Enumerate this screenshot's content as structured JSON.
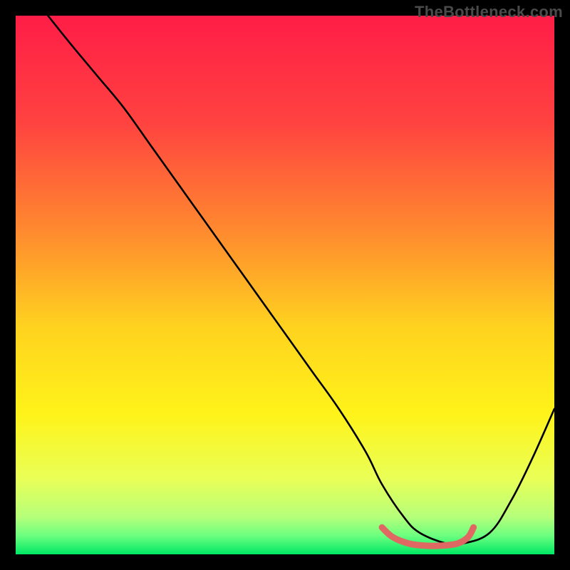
{
  "watermark": "TheBottleneck.com",
  "chart_data": {
    "type": "line",
    "title": "",
    "xlabel": "",
    "ylabel": "",
    "xlim": [
      0,
      100
    ],
    "ylim": [
      0,
      100
    ],
    "grid": false,
    "legend": false,
    "gradient_stops": [
      {
        "offset": 0.0,
        "color": "#ff1d47"
      },
      {
        "offset": 0.2,
        "color": "#ff4340"
      },
      {
        "offset": 0.4,
        "color": "#ff8a2f"
      },
      {
        "offset": 0.58,
        "color": "#ffd31f"
      },
      {
        "offset": 0.74,
        "color": "#fff31a"
      },
      {
        "offset": 0.86,
        "color": "#e9ff57"
      },
      {
        "offset": 0.93,
        "color": "#b6ff7a"
      },
      {
        "offset": 0.965,
        "color": "#6dff7f"
      },
      {
        "offset": 1.0,
        "color": "#00e865"
      }
    ],
    "series": [
      {
        "name": "bottleneck-curve",
        "color": "#000000",
        "x": [
          6,
          10,
          15,
          20,
          25,
          30,
          35,
          40,
          45,
          50,
          55,
          60,
          65,
          68,
          72,
          75,
          80,
          83,
          88,
          92,
          96,
          100
        ],
        "y": [
          100,
          95,
          89,
          83,
          76,
          69,
          62,
          55,
          48,
          41,
          34,
          27,
          19,
          13,
          7,
          4,
          2,
          2,
          4,
          10,
          18,
          27
        ]
      },
      {
        "name": "optimal-range-marker",
        "color": "#df6862",
        "x": [
          68,
          70,
          73,
          76,
          79,
          82,
          84,
          85
        ],
        "y": [
          5.0,
          3.2,
          2.0,
          1.6,
          1.6,
          2.0,
          3.2,
          5.0
        ]
      }
    ],
    "annotations": []
  }
}
